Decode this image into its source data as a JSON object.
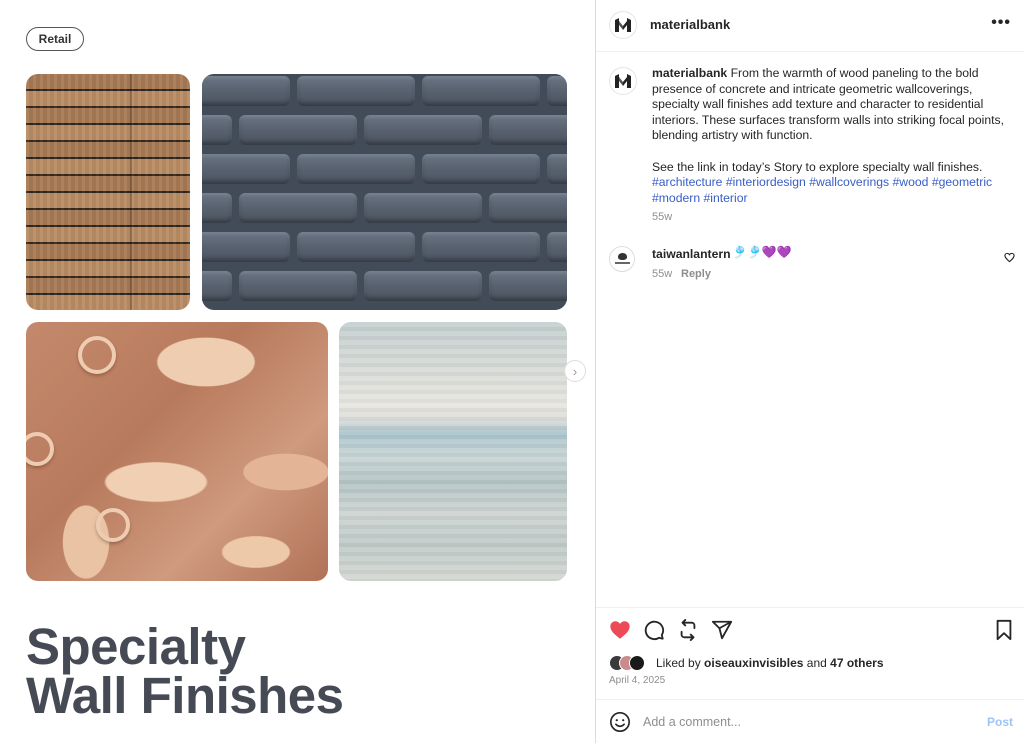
{
  "post_image": {
    "tag_label": "Retail",
    "headline_line1": "Specialty",
    "headline_line2": "Wall Finishes"
  },
  "header": {
    "username": "materialbank",
    "more_icon": "more-horizontal-icon"
  },
  "caption": {
    "username": "materialbank",
    "text": "From the warmth of wood paneling to the bold presence of concrete and intricate geometric wallcoverings, specialty wall finishes add texture and character to residential interiors. These surfaces transform walls into striking focal points, blending artistry with function.",
    "cta": "See the link in today’s Story to explore specialty wall finishes.",
    "hashtags": [
      "#architecture",
      "#interiordesign",
      "#wallcoverings",
      "#wood",
      "#geometric",
      "#modern",
      "#interior"
    ],
    "time": "55w"
  },
  "comments": [
    {
      "username": "taiwanlantern",
      "text": "🎐🎐💜💜",
      "time": "55w",
      "reply_label": "Reply"
    }
  ],
  "likes": {
    "prefix": "Liked by",
    "user": "oiseauxinvisibles",
    "joiner": "and",
    "others": "47 others"
  },
  "date": "April 4, 2025",
  "comment_input": {
    "placeholder": "Add a comment...",
    "post_label": "Post"
  },
  "colors": {
    "like_red": "#ed4956",
    "hashtag_blue": "#385dc8",
    "post_button_blue": "#9fc3f5"
  }
}
